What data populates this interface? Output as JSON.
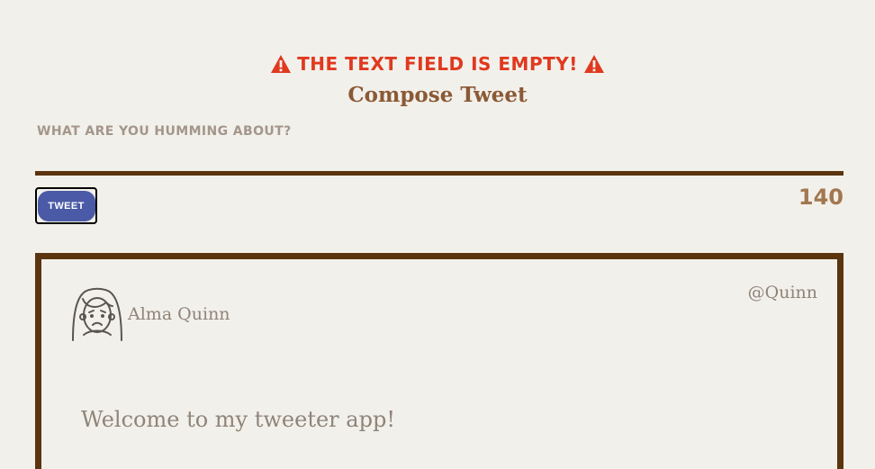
{
  "error": {
    "message": "The text field is empty!",
    "icon": "warning-icon",
    "color": "#e0391f"
  },
  "compose": {
    "title": "Compose Tweet",
    "label": "What are you humming about?",
    "input_value": "",
    "button_label": "Tweet",
    "char_count": "140"
  },
  "tweet": {
    "author_name": "Alma Quinn",
    "handle": "@Quinn",
    "avatar_icon": "user-avatar-icon",
    "text": "Welcome to my tweeter app!"
  },
  "colors": {
    "background": "#f2f0eb",
    "accent_brown": "#5b3410",
    "title_brown": "#8a5a35",
    "button_blue": "#4a5aa6",
    "muted_text": "#8f8478"
  }
}
